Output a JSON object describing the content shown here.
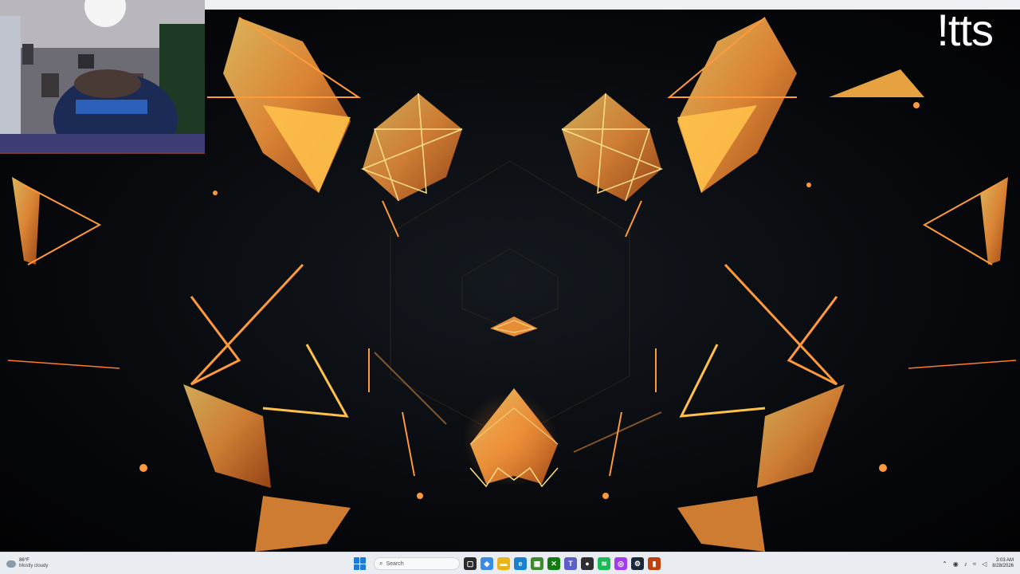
{
  "stream_overlay": {
    "command_text": "!tts"
  },
  "taskbar": {
    "weather": {
      "temperature": "86°F",
      "condition": "Mostly cloudy",
      "icon": "cloud-icon"
    },
    "search": {
      "label": "Search",
      "icon": "search-icon"
    },
    "apps": [
      {
        "name": "task-view-icon",
        "color": "#2b2b2b",
        "glyph": "▢"
      },
      {
        "name": "copilot-icon",
        "color": "#3b8be0",
        "glyph": "◆"
      },
      {
        "name": "file-explorer-icon",
        "color": "#e9b51c",
        "glyph": "▬"
      },
      {
        "name": "edge-icon",
        "color": "#1b7fcf",
        "glyph": "e"
      },
      {
        "name": "minecraft-icon",
        "color": "#3f8a2f",
        "glyph": "▦"
      },
      {
        "name": "xbox-icon",
        "color": "#107c10",
        "glyph": "✕"
      },
      {
        "name": "teams-icon",
        "color": "#5b5fc7",
        "glyph": "T"
      },
      {
        "name": "obs-icon",
        "color": "#302e31",
        "glyph": "●"
      },
      {
        "name": "spotify-icon",
        "color": "#1db954",
        "glyph": "≋"
      },
      {
        "name": "messenger-icon",
        "color": "#a33bf2",
        "glyph": "◎"
      },
      {
        "name": "steam-icon",
        "color": "#1b2838",
        "glyph": "⚙"
      },
      {
        "name": "app-icon",
        "color": "#c0400e",
        "glyph": "▮"
      }
    ],
    "tray": {
      "icons": [
        "chevron-up-icon",
        "network-icon",
        "microphone-icon",
        "wifi-icon",
        "volume-icon"
      ],
      "time": "3:03 AM",
      "date": "8/28/2026"
    }
  },
  "colors": {
    "flame": "#ff9a3c",
    "flame_bright": "#ffc14a",
    "taskbar": "#e9edf2",
    "windows_blue": "#1f7ad8"
  }
}
